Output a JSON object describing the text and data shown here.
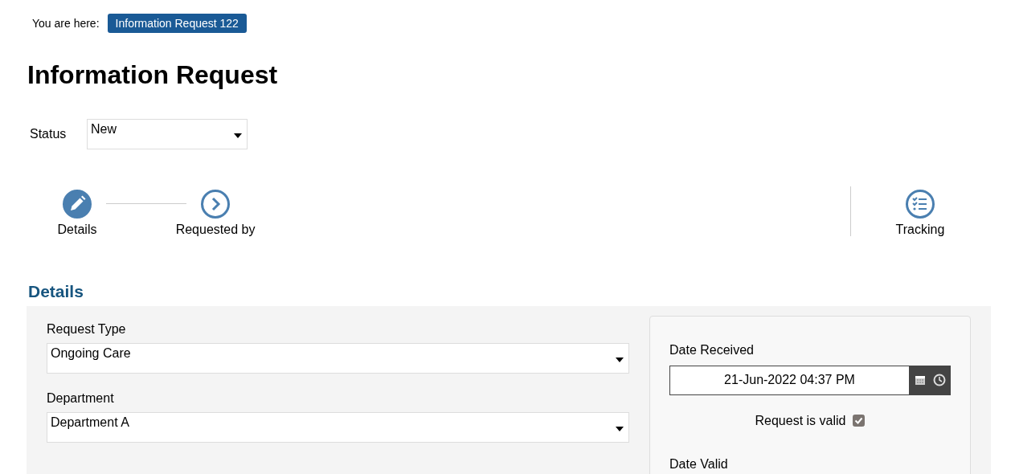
{
  "breadcrumb": {
    "label": "You are here:",
    "current": "Information Request 122"
  },
  "title": "Information Request",
  "status": {
    "label": "Status",
    "value": "New"
  },
  "steps": [
    {
      "label": "Details",
      "kind": "edit",
      "selected": true
    },
    {
      "label": "Requested by",
      "kind": "next",
      "selected": false
    }
  ],
  "side_step": {
    "label": "Tracking",
    "selected": false
  },
  "section": {
    "title": "Details",
    "fields": [
      {
        "label": "Request Type",
        "value": "Ongoing Care"
      },
      {
        "label": "Department",
        "value": "Department A"
      }
    ],
    "card": {
      "date_label": "Date Received",
      "date_value": "21-Jun-2022 04:37 PM",
      "checkbox_label": "Request is valid",
      "checked": true,
      "next_label": "Date Valid"
    }
  }
}
